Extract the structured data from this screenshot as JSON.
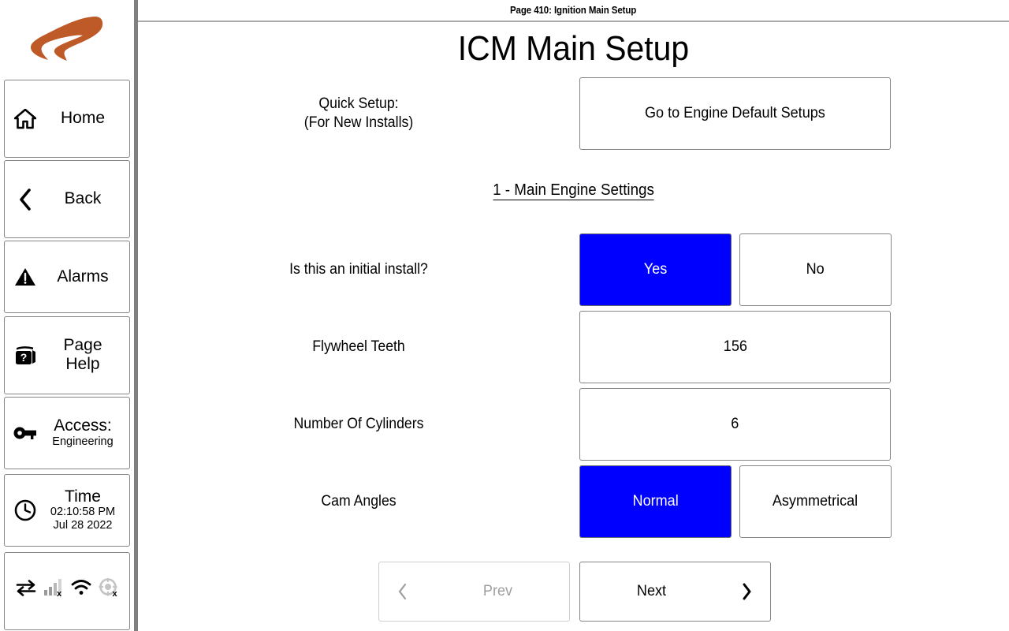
{
  "brand": {
    "logo_icon": "swoosh-logo",
    "logo_color": "#bd5a28"
  },
  "sidebar": {
    "items": [
      {
        "id": "home",
        "icon": "home-icon",
        "label": "Home"
      },
      {
        "id": "back",
        "icon": "chevron-left-icon",
        "label": "Back"
      },
      {
        "id": "alarms",
        "icon": "warning-triangle-icon",
        "label": "Alarms"
      },
      {
        "id": "help",
        "icon": "page-help-icon",
        "label": "Page",
        "label2": "Help"
      },
      {
        "id": "access",
        "icon": "key-icon",
        "label": "Access:",
        "sub": "Engineering"
      },
      {
        "id": "time",
        "icon": "clock-icon",
        "label": "Time",
        "time": "02:10:58 PM",
        "date": "Jul 28 2022"
      }
    ],
    "status_icons": [
      {
        "name": "data-transfer-icon",
        "state": "active"
      },
      {
        "name": "cell-signal-off-icon",
        "state": "disabled"
      },
      {
        "name": "wifi-icon",
        "state": "active"
      },
      {
        "name": "gps-off-icon",
        "state": "disabled"
      }
    ]
  },
  "header": {
    "page_bar": "Page 410: Ignition Main Setup",
    "title": "ICM Main Setup"
  },
  "main": {
    "quick_setup": {
      "label_line1": "Quick Setup:",
      "label_line2": "(For New Installs)",
      "button_label": "Go to Engine Default Setups"
    },
    "section_heading": "1 - Main Engine Settings",
    "rows": [
      {
        "id": "initial-install",
        "label": "Is this an initial install?",
        "type": "toggle",
        "options": [
          "Yes",
          "No"
        ],
        "selected": "Yes"
      },
      {
        "id": "flywheel-teeth",
        "label": "Flywheel Teeth",
        "type": "value",
        "value": "156"
      },
      {
        "id": "number-of-cylinders",
        "label": "Number Of Cylinders",
        "type": "value",
        "value": "6"
      },
      {
        "id": "cam-angles",
        "label": "Cam Angles",
        "type": "toggle",
        "options": [
          "Normal",
          "Asymmetrical"
        ],
        "selected": "Normal"
      }
    ],
    "nav": {
      "prev_label": "Prev",
      "prev_enabled": false,
      "next_label": "Next",
      "next_enabled": true,
      "prev_icon": "chevron-left-icon",
      "next_icon": "chevron-right-icon"
    }
  },
  "colors": {
    "selected": "#0000ff",
    "selected_text": "#ffffff",
    "border": "#848484",
    "disabled_text": "#9e9e9e"
  }
}
